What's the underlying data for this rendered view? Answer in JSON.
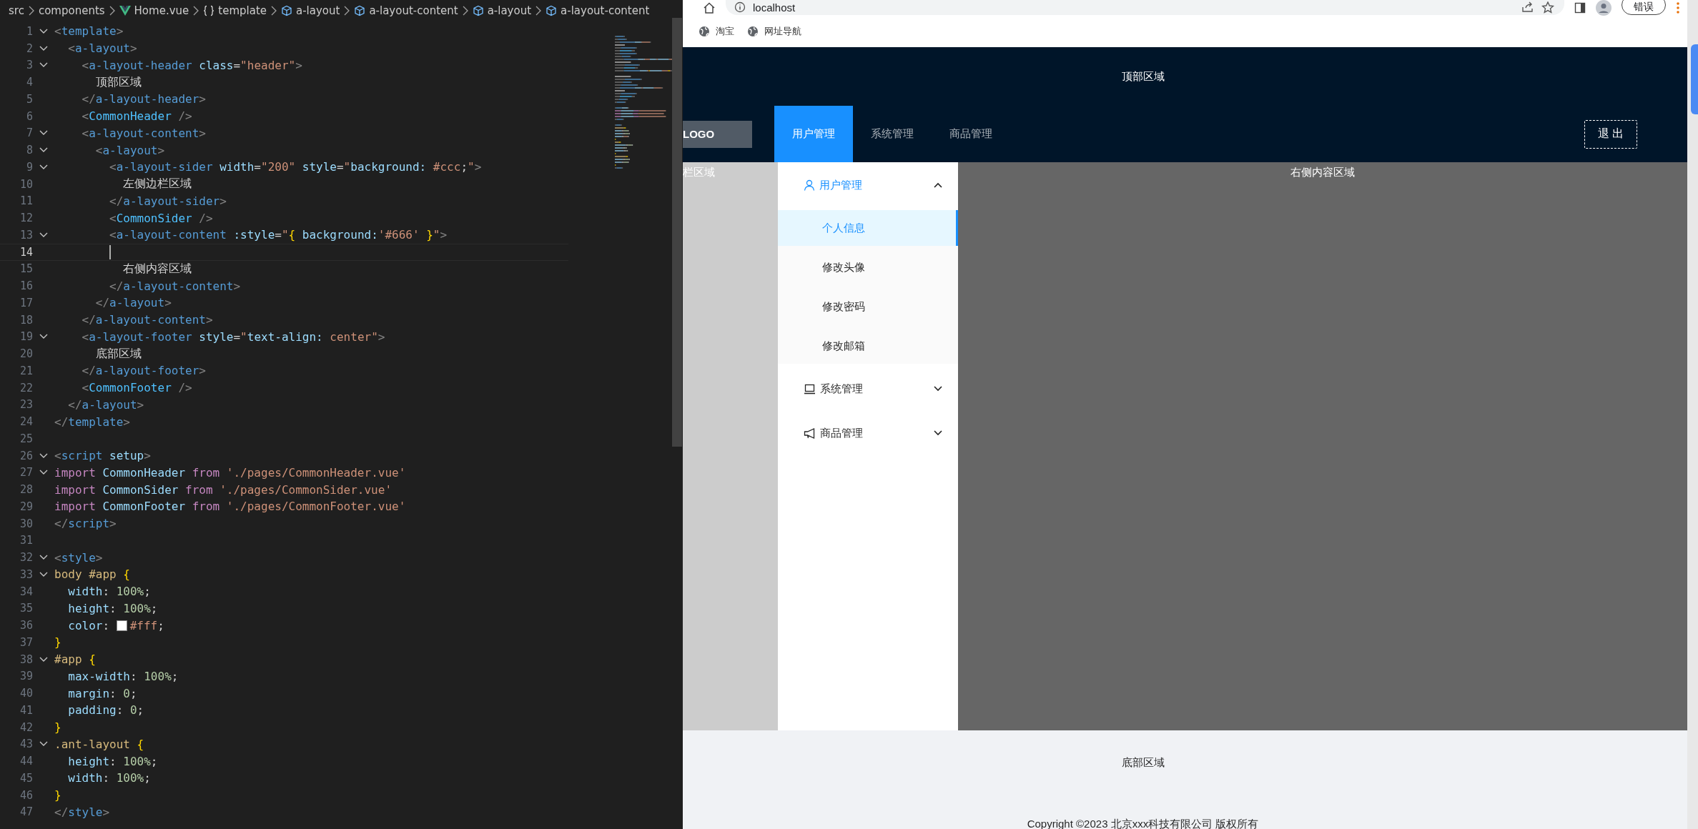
{
  "editor": {
    "breadcrumbs": [
      {
        "label": "src"
      },
      {
        "label": "components"
      },
      {
        "label": "Home.vue"
      },
      {
        "label": "template"
      },
      {
        "label": "a-layout"
      },
      {
        "label": "a-layout-content"
      },
      {
        "label": "a-layout"
      },
      {
        "label": "a-layout-content"
      }
    ],
    "lines": [
      {
        "n": "1",
        "fold": true,
        "selected": false,
        "tokens": [
          {
            "kind": "punct",
            "text": "<"
          },
          {
            "kind": "tag",
            "text": "template"
          },
          {
            "kind": "punct",
            "text": ">"
          }
        ]
      },
      {
        "n": "2",
        "fold": true,
        "selected": false,
        "tokens": [
          {
            "kind": "punct",
            "text": "  <"
          },
          {
            "kind": "tag",
            "text": "a-layout"
          },
          {
            "kind": "punct",
            "text": ">"
          }
        ]
      },
      {
        "n": "3",
        "fold": true,
        "selected": false,
        "tokens": [
          {
            "kind": "punct",
            "text": "    <"
          },
          {
            "kind": "tag",
            "text": "a-layout-header"
          },
          {
            "kind": "attr",
            "text": " class"
          },
          {
            "kind": "text",
            "text": "="
          },
          {
            "kind": "str",
            "text": "\"header\""
          },
          {
            "kind": "punct",
            "text": ">"
          }
        ]
      },
      {
        "n": "4",
        "fold": false,
        "selected": false,
        "tokens": [
          {
            "kind": "text",
            "text": "      顶部区域"
          }
        ]
      },
      {
        "n": "5",
        "fold": false,
        "selected": false,
        "tokens": [
          {
            "kind": "punct",
            "text": "    </"
          },
          {
            "kind": "tag",
            "text": "a-layout-header"
          },
          {
            "kind": "punct",
            "text": ">"
          }
        ]
      },
      {
        "n": "6",
        "fold": false,
        "selected": false,
        "tokens": [
          {
            "kind": "punct",
            "text": "    <"
          },
          {
            "kind": "comp",
            "text": "CommonHeader"
          },
          {
            "kind": "punct",
            "text": " />"
          }
        ]
      },
      {
        "n": "7",
        "fold": true,
        "selected": false,
        "tokens": [
          {
            "kind": "punct",
            "text": "    <"
          },
          {
            "kind": "tag",
            "text": "a-layout-content"
          },
          {
            "kind": "punct",
            "text": ">"
          }
        ]
      },
      {
        "n": "8",
        "fold": true,
        "selected": false,
        "tokens": [
          {
            "kind": "punct",
            "text": "      <"
          },
          {
            "kind": "tag",
            "text": "a-layout"
          },
          {
            "kind": "punct",
            "text": ">"
          }
        ]
      },
      {
        "n": "9",
        "fold": true,
        "selected": false,
        "tokens": [
          {
            "kind": "punct",
            "text": "        <"
          },
          {
            "kind": "tag",
            "text": "a-layout-sider"
          },
          {
            "kind": "attr",
            "text": " width"
          },
          {
            "kind": "text",
            "text": "="
          },
          {
            "kind": "str",
            "text": "\"200\""
          },
          {
            "kind": "attr",
            "text": " style"
          },
          {
            "kind": "text",
            "text": "="
          },
          {
            "kind": "str",
            "text": "\""
          },
          {
            "kind": "attr",
            "text": "background:"
          },
          {
            "kind": "str",
            "text": " #ccc"
          },
          {
            "kind": "text",
            "text": ";"
          },
          {
            "kind": "str",
            "text": "\""
          },
          {
            "kind": "punct",
            "text": ">"
          }
        ]
      },
      {
        "n": "10",
        "fold": false,
        "selected": false,
        "tokens": [
          {
            "kind": "text",
            "text": "          左侧边栏区域"
          }
        ]
      },
      {
        "n": "11",
        "fold": false,
        "selected": false,
        "tokens": [
          {
            "kind": "punct",
            "text": "        </"
          },
          {
            "kind": "tag",
            "text": "a-layout-sider"
          },
          {
            "kind": "punct",
            "text": ">"
          }
        ]
      },
      {
        "n": "12",
        "fold": false,
        "selected": false,
        "tokens": [
          {
            "kind": "punct",
            "text": "        <"
          },
          {
            "kind": "comp",
            "text": "CommonSider"
          },
          {
            "kind": "punct",
            "text": " />"
          }
        ]
      },
      {
        "n": "13",
        "fold": true,
        "selected": false,
        "tokens": [
          {
            "kind": "punct",
            "text": "        <"
          },
          {
            "kind": "tag",
            "text": "a-layout-content"
          },
          {
            "kind": "attr",
            "text": " :style"
          },
          {
            "kind": "text",
            "text": "="
          },
          {
            "kind": "str",
            "text": "\""
          },
          {
            "kind": "brace",
            "text": "{"
          },
          {
            "kind": "attr",
            "text": " background:"
          },
          {
            "kind": "str",
            "text": "'#666'"
          },
          {
            "kind": "brace",
            "text": " }"
          },
          {
            "kind": "str",
            "text": "\""
          },
          {
            "kind": "punct",
            "text": ">"
          }
        ]
      },
      {
        "n": "14",
        "fold": false,
        "selected": true
      },
      {
        "n": "15",
        "fold": false,
        "selected": false,
        "tokens": [
          {
            "kind": "text",
            "text": "          右侧内容区域"
          }
        ]
      },
      {
        "n": "16",
        "fold": false,
        "selected": false,
        "tokens": [
          {
            "kind": "punct",
            "text": "        </"
          },
          {
            "kind": "tag",
            "text": "a-layout-content"
          },
          {
            "kind": "punct",
            "text": ">"
          }
        ]
      },
      {
        "n": "17",
        "fold": false,
        "selected": false,
        "tokens": [
          {
            "kind": "punct",
            "text": "      </"
          },
          {
            "kind": "tag",
            "text": "a-layout"
          },
          {
            "kind": "punct",
            "text": ">"
          }
        ]
      },
      {
        "n": "18",
        "fold": false,
        "selected": false,
        "tokens": [
          {
            "kind": "punct",
            "text": "    </"
          },
          {
            "kind": "tag",
            "text": "a-layout-content"
          },
          {
            "kind": "punct",
            "text": ">"
          }
        ]
      },
      {
        "n": "19",
        "fold": true,
        "selected": false,
        "tokens": [
          {
            "kind": "punct",
            "text": "    <"
          },
          {
            "kind": "tag",
            "text": "a-layout-footer"
          },
          {
            "kind": "attr",
            "text": " style"
          },
          {
            "kind": "text",
            "text": "="
          },
          {
            "kind": "str",
            "text": "\""
          },
          {
            "kind": "attr",
            "text": "text-align:"
          },
          {
            "kind": "str",
            "text": " center"
          },
          {
            "kind": "str",
            "text": "\""
          },
          {
            "kind": "punct",
            "text": ">"
          }
        ]
      },
      {
        "n": "20",
        "fold": false,
        "selected": false,
        "tokens": [
          {
            "kind": "text",
            "text": "      底部区域"
          }
        ]
      },
      {
        "n": "21",
        "fold": false,
        "selected": false,
        "tokens": [
          {
            "kind": "punct",
            "text": "    </"
          },
          {
            "kind": "tag",
            "text": "a-layout-footer"
          },
          {
            "kind": "punct",
            "text": ">"
          }
        ]
      },
      {
        "n": "22",
        "fold": false,
        "selected": false,
        "tokens": [
          {
            "kind": "punct",
            "text": "    <"
          },
          {
            "kind": "comp",
            "text": "CommonFooter"
          },
          {
            "kind": "punct",
            "text": " />"
          }
        ]
      },
      {
        "n": "23",
        "fold": false,
        "selected": false,
        "tokens": [
          {
            "kind": "punct",
            "text": "  </"
          },
          {
            "kind": "tag",
            "text": "a-layout"
          },
          {
            "kind": "punct",
            "text": ">"
          }
        ]
      },
      {
        "n": "24",
        "fold": false,
        "selected": false,
        "tokens": [
          {
            "kind": "punct",
            "text": "</"
          },
          {
            "kind": "tag",
            "text": "template"
          },
          {
            "kind": "punct",
            "text": ">"
          }
        ]
      },
      {
        "n": "25",
        "fold": false,
        "selected": false
      },
      {
        "n": "26",
        "fold": true,
        "selected": false,
        "tokens": [
          {
            "kind": "punct",
            "text": "<"
          },
          {
            "kind": "tag",
            "text": "script"
          },
          {
            "kind": "attr",
            "text": " setup"
          },
          {
            "kind": "punct",
            "text": ">"
          }
        ]
      },
      {
        "n": "27",
        "fold": true,
        "selected": false,
        "tokens": [
          {
            "kind": "kw",
            "text": "import"
          },
          {
            "kind": "var",
            "text": " CommonHeader"
          },
          {
            "kind": "kw",
            "text": " from"
          },
          {
            "kind": "str",
            "text": " './pages/CommonHeader.vue'"
          }
        ]
      },
      {
        "n": "28",
        "fold": false,
        "selected": false,
        "tokens": [
          {
            "kind": "kw",
            "text": "import"
          },
          {
            "kind": "var",
            "text": " CommonSider"
          },
          {
            "kind": "kw",
            "text": " from"
          },
          {
            "kind": "str",
            "text": " './pages/CommonSider.vue'"
          }
        ]
      },
      {
        "n": "29",
        "fold": false,
        "selected": false,
        "tokens": [
          {
            "kind": "kw",
            "text": "import"
          },
          {
            "kind": "var",
            "text": " CommonFooter"
          },
          {
            "kind": "kw",
            "text": " from"
          },
          {
            "kind": "str",
            "text": " './pages/CommonFooter.vue'"
          }
        ]
      },
      {
        "n": "30",
        "fold": false,
        "selected": false,
        "tokens": [
          {
            "kind": "punct",
            "text": "</"
          },
          {
            "kind": "tag",
            "text": "script"
          },
          {
            "kind": "punct",
            "text": ">"
          }
        ]
      },
      {
        "n": "31",
        "fold": false,
        "selected": false
      },
      {
        "n": "32",
        "fold": true,
        "selected": false,
        "tokens": [
          {
            "kind": "punct",
            "text": "<"
          },
          {
            "kind": "tag",
            "text": "style"
          },
          {
            "kind": "punct",
            "text": ">"
          }
        ]
      },
      {
        "n": "33",
        "fold": true,
        "selected": false,
        "tokens": [
          {
            "kind": "sel",
            "text": "body #app"
          },
          {
            "kind": "brace",
            "text": " {"
          }
        ]
      },
      {
        "n": "34",
        "fold": false,
        "selected": false,
        "tokens": [
          {
            "kind": "attr",
            "text": "  width"
          },
          {
            "kind": "text",
            "text": ": "
          },
          {
            "kind": "num",
            "text": "100%"
          },
          {
            "kind": "text",
            "text": ";"
          }
        ]
      },
      {
        "n": "35",
        "fold": false,
        "selected": false,
        "tokens": [
          {
            "kind": "attr",
            "text": "  height"
          },
          {
            "kind": "text",
            "text": ": "
          },
          {
            "kind": "num",
            "text": "100%"
          },
          {
            "kind": "text",
            "text": ";"
          }
        ]
      },
      {
        "n": "36",
        "fold": false,
        "selected": false,
        "tokens": [
          {
            "kind": "attr",
            "text": "  color"
          },
          {
            "kind": "text",
            "text": ": "
          },
          {
            "kind": "colorval",
            "text": "#fff"
          },
          {
            "kind": "text",
            "text": ";"
          }
        ]
      },
      {
        "n": "37",
        "fold": false,
        "selected": false,
        "tokens": [
          {
            "kind": "brace",
            "text": "}"
          }
        ]
      },
      {
        "n": "38",
        "fold": true,
        "selected": false,
        "tokens": [
          {
            "kind": "sel",
            "text": "#app"
          },
          {
            "kind": "brace",
            "text": " {"
          }
        ]
      },
      {
        "n": "39",
        "fold": false,
        "selected": false,
        "tokens": [
          {
            "kind": "attr",
            "text": "  max-width"
          },
          {
            "kind": "text",
            "text": ": "
          },
          {
            "kind": "num",
            "text": "100%"
          },
          {
            "kind": "text",
            "text": ";"
          }
        ]
      },
      {
        "n": "40",
        "fold": false,
        "selected": false,
        "tokens": [
          {
            "kind": "attr",
            "text": "  margin"
          },
          {
            "kind": "text",
            "text": ": "
          },
          {
            "kind": "num",
            "text": "0"
          },
          {
            "kind": "text",
            "text": ";"
          }
        ]
      },
      {
        "n": "41",
        "fold": false,
        "selected": false,
        "tokens": [
          {
            "kind": "attr",
            "text": "  padding"
          },
          {
            "kind": "text",
            "text": ": "
          },
          {
            "kind": "num",
            "text": "0"
          },
          {
            "kind": "text",
            "text": ";"
          }
        ]
      },
      {
        "n": "42",
        "fold": false,
        "selected": false,
        "tokens": [
          {
            "kind": "brace",
            "text": "}"
          }
        ]
      },
      {
        "n": "43",
        "fold": true,
        "selected": false,
        "tokens": [
          {
            "kind": "sel",
            "text": ".ant-layout"
          },
          {
            "kind": "brace",
            "text": " {"
          }
        ]
      },
      {
        "n": "44",
        "fold": false,
        "selected": false,
        "tokens": [
          {
            "kind": "attr",
            "text": "  height"
          },
          {
            "kind": "text",
            "text": ": "
          },
          {
            "kind": "num",
            "text": "100%"
          },
          {
            "kind": "text",
            "text": ";"
          }
        ]
      },
      {
        "n": "45",
        "fold": false,
        "selected": false,
        "tokens": [
          {
            "kind": "attr",
            "text": "  width"
          },
          {
            "kind": "text",
            "text": ": "
          },
          {
            "kind": "num",
            "text": "100%"
          },
          {
            "kind": "text",
            "text": ";"
          }
        ]
      },
      {
        "n": "46",
        "fold": false,
        "selected": false,
        "tokens": [
          {
            "kind": "brace",
            "text": "}"
          }
        ]
      },
      {
        "n": "47",
        "fold": false,
        "selected": false,
        "tokens": [
          {
            "kind": "punct",
            "text": "</"
          },
          {
            "kind": "tag",
            "text": "style"
          },
          {
            "kind": "punct",
            "text": ">"
          }
        ]
      }
    ]
  },
  "browser": {
    "address": "localhost",
    "profile_button": "错误",
    "bookmarks": [
      {
        "label": "淘宝"
      },
      {
        "label": "网址导航"
      }
    ],
    "header": {
      "title": "顶部区域",
      "logo": "LOGO",
      "logout": "退 出",
      "nav": [
        {
          "label": "用户管理",
          "selected": true
        },
        {
          "label": "系统管理",
          "selected": false
        },
        {
          "label": "商品管理",
          "selected": false
        }
      ]
    },
    "sider": {
      "text": "栏区域"
    },
    "menu": [
      {
        "label": "用户管理",
        "expanded": true,
        "children": [
          {
            "label": "个人信息",
            "selected": true
          },
          {
            "label": "修改头像",
            "selected": false
          },
          {
            "label": "修改密码",
            "selected": false
          },
          {
            "label": "修改邮箱",
            "selected": false
          }
        ]
      },
      {
        "label": "系统管理",
        "expanded": false
      },
      {
        "label": "商品管理",
        "expanded": false
      }
    ],
    "content": {
      "text": "右侧内容区域"
    },
    "footer": {
      "title": "底部区域",
      "copyright": "Copyright ©2023 北京xxx科技有限公司 版权所有"
    }
  }
}
